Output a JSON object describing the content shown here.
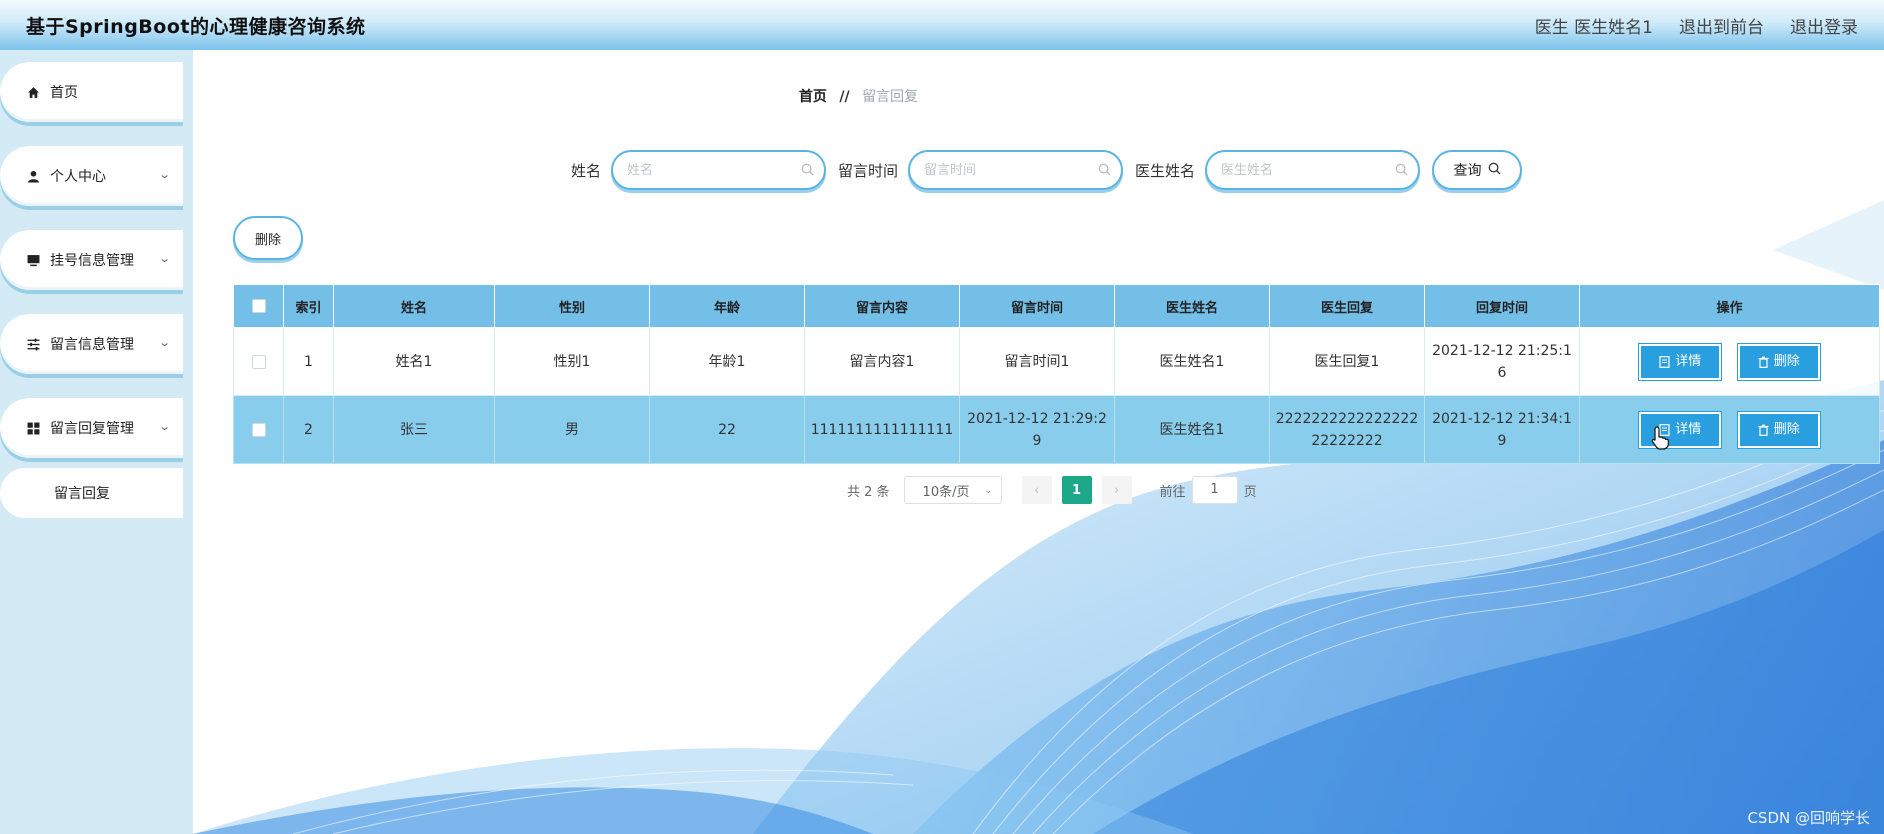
{
  "header": {
    "title": "基于SpringBoot的心理健康咨询系统",
    "user_label": "医生 医生姓名1",
    "back_front": "退出到前台",
    "logout": "退出登录"
  },
  "sidebar": {
    "items": [
      {
        "label": "首页",
        "icon": "home-icon"
      },
      {
        "label": "个人中心",
        "icon": "user-icon"
      },
      {
        "label": "挂号信息管理",
        "icon": "monitor-icon"
      },
      {
        "label": "留言信息管理",
        "icon": "sliders-icon"
      },
      {
        "label": "留言回复管理",
        "icon": "grid-icon"
      }
    ],
    "sub_item": "留言回复"
  },
  "breadcrumb": {
    "home": "首页",
    "separator": "//",
    "current": "留言回复"
  },
  "search": {
    "name_label": "姓名",
    "name_placeholder": "姓名",
    "time_label": "留言时间",
    "time_placeholder": "留言时间",
    "doctor_label": "医生姓名",
    "doctor_placeholder": "医生姓名",
    "query_label": "查询"
  },
  "toolbar": {
    "delete_label": "删除"
  },
  "table": {
    "headers": [
      "索引",
      "姓名",
      "性别",
      "年龄",
      "留言内容",
      "留言时间",
      "医生姓名",
      "医生回复",
      "回复时间",
      "操作"
    ],
    "rows": [
      {
        "index": "1",
        "name": "姓名1",
        "gender": "性别1",
        "age": "年龄1",
        "content": "留言内容1",
        "msg_time": "留言时间1",
        "doctor": "医生姓名1",
        "reply": "医生回复1",
        "reply_time": "2021-12-12 21:25:16"
      },
      {
        "index": "2",
        "name": "张三",
        "gender": "男",
        "age": "22",
        "content": "1111111111111111",
        "msg_time": "2021-12-12 21:29:29",
        "doctor": "医生姓名1",
        "reply": "222222222222222222222222",
        "reply_time": "2021-12-12 21:34:19"
      }
    ],
    "detail_label": "详情",
    "delete_label": "删除"
  },
  "pagination": {
    "total": "共 2 条",
    "page_size": "10条/页",
    "current_page": "1",
    "goto_label": "前往",
    "goto_value": "1",
    "page_suffix": "页"
  },
  "watermark": "CSDN @回响学长",
  "colors": {
    "accent": "#2a9fe0",
    "header_bg": "#7cc3ec",
    "table_header": "#74bfe8",
    "active_page": "#1ea88a"
  }
}
